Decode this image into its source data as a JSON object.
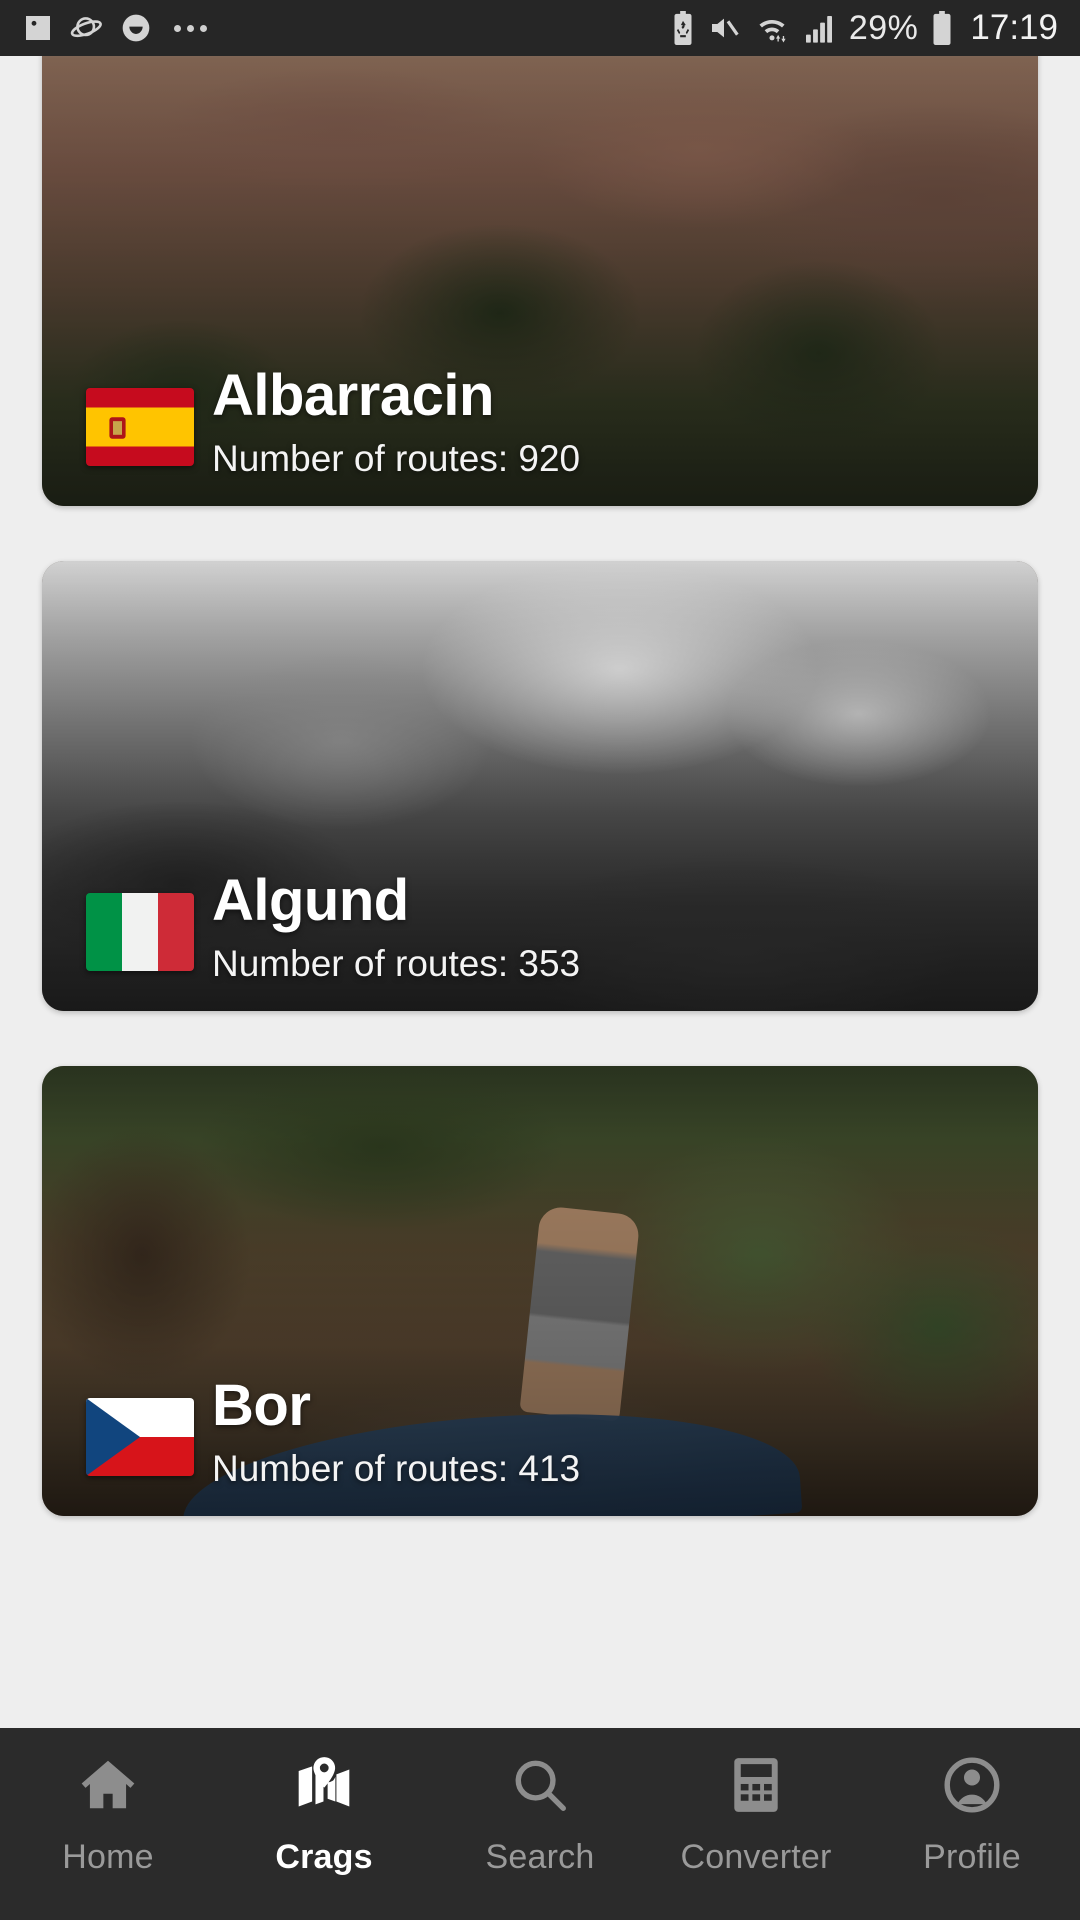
{
  "status_bar": {
    "left_icons": [
      {
        "name": "photo-icon",
        "glyph": "image"
      },
      {
        "name": "planet-icon",
        "glyph": "saturn"
      },
      {
        "name": "smiley-icon",
        "glyph": "smile"
      },
      {
        "name": "more-notifications-icon",
        "glyph": "ellipsis"
      }
    ],
    "right_icons": [
      {
        "name": "battery-saver-icon",
        "glyph": "battery-recycle"
      },
      {
        "name": "mute-icon",
        "glyph": "speaker-muted"
      },
      {
        "name": "wifi-icon",
        "glyph": "wifi-transfer"
      },
      {
        "name": "signal-icon",
        "glyph": "cellular-bars"
      }
    ],
    "battery_percent": "29%",
    "clock": "17:19"
  },
  "screen": {
    "background_color": "#eeeeee"
  },
  "crags": [
    {
      "name": "Albarracin",
      "routes_label": "Number of routes: 920",
      "flag": "spain-flag-icon",
      "country": "Spain",
      "photo": "albarracin-sandstone-cliff-photo"
    },
    {
      "name": "Algund",
      "routes_label": "Number of routes: 353",
      "flag": "italy-flag-icon",
      "country": "Italy",
      "photo": "algund-snowy-boulder-photo"
    },
    {
      "name": "Bor",
      "routes_label": "Number of routes: 413",
      "flag": "czech-republic-flag-icon",
      "country": "Czech Republic",
      "photo": "bor-forest-boulder-climber-photo"
    }
  ],
  "bottom_nav": {
    "active_index": 1,
    "items": [
      {
        "label": "Home",
        "icon": "home-icon"
      },
      {
        "label": "Crags",
        "icon": "map-pin-icon"
      },
      {
        "label": "Search",
        "icon": "search-icon"
      },
      {
        "label": "Converter",
        "icon": "calculator-icon"
      },
      {
        "label": "Profile",
        "icon": "person-icon"
      }
    ]
  }
}
